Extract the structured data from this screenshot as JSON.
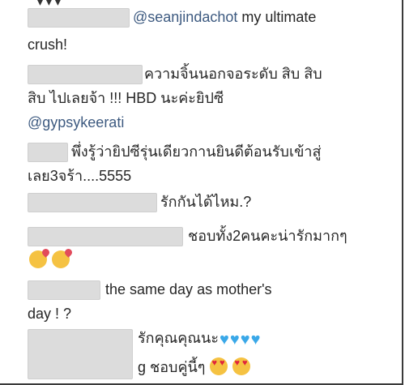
{
  "comments": [
    {
      "text1": "@seanjindachot",
      "text2": " my ultimate",
      "text3": "crush!"
    },
    {
      "text1": "ความจิ้นนอกจอระดับ สิบ สิบ",
      "text2": "สิบ ไปเลยจ้า !!! HBD นะค่ะยิปซี",
      "mention": "@gypsykeerati"
    },
    {
      "text1": "พึ่งรู้ว่ายิปซีรุ่นเดียวกานยินดีต้อนรับเข้าสู่",
      "text2": "เลย3จร้า....5555"
    },
    {
      "text1": "รักกันได้ไหม.?"
    },
    {
      "text1": "ชอบทั้ง2คนคะน่ารักมากๆ"
    },
    {
      "text1": "the same day as mother's",
      "text2": "day ! ?"
    },
    {
      "text1": "รักคุณคุณนะ",
      "text2": "g ชอบคู่นี้ๆ"
    }
  ],
  "icons": {
    "kiss": "face-blowing-kiss-icon",
    "heart": "blue-heart-icon",
    "hearteyes": "heart-eyes-icon"
  },
  "colors": {
    "mention": "#3d5a80",
    "blur": "#dcdcdc",
    "heart": "#3aa8e8"
  }
}
